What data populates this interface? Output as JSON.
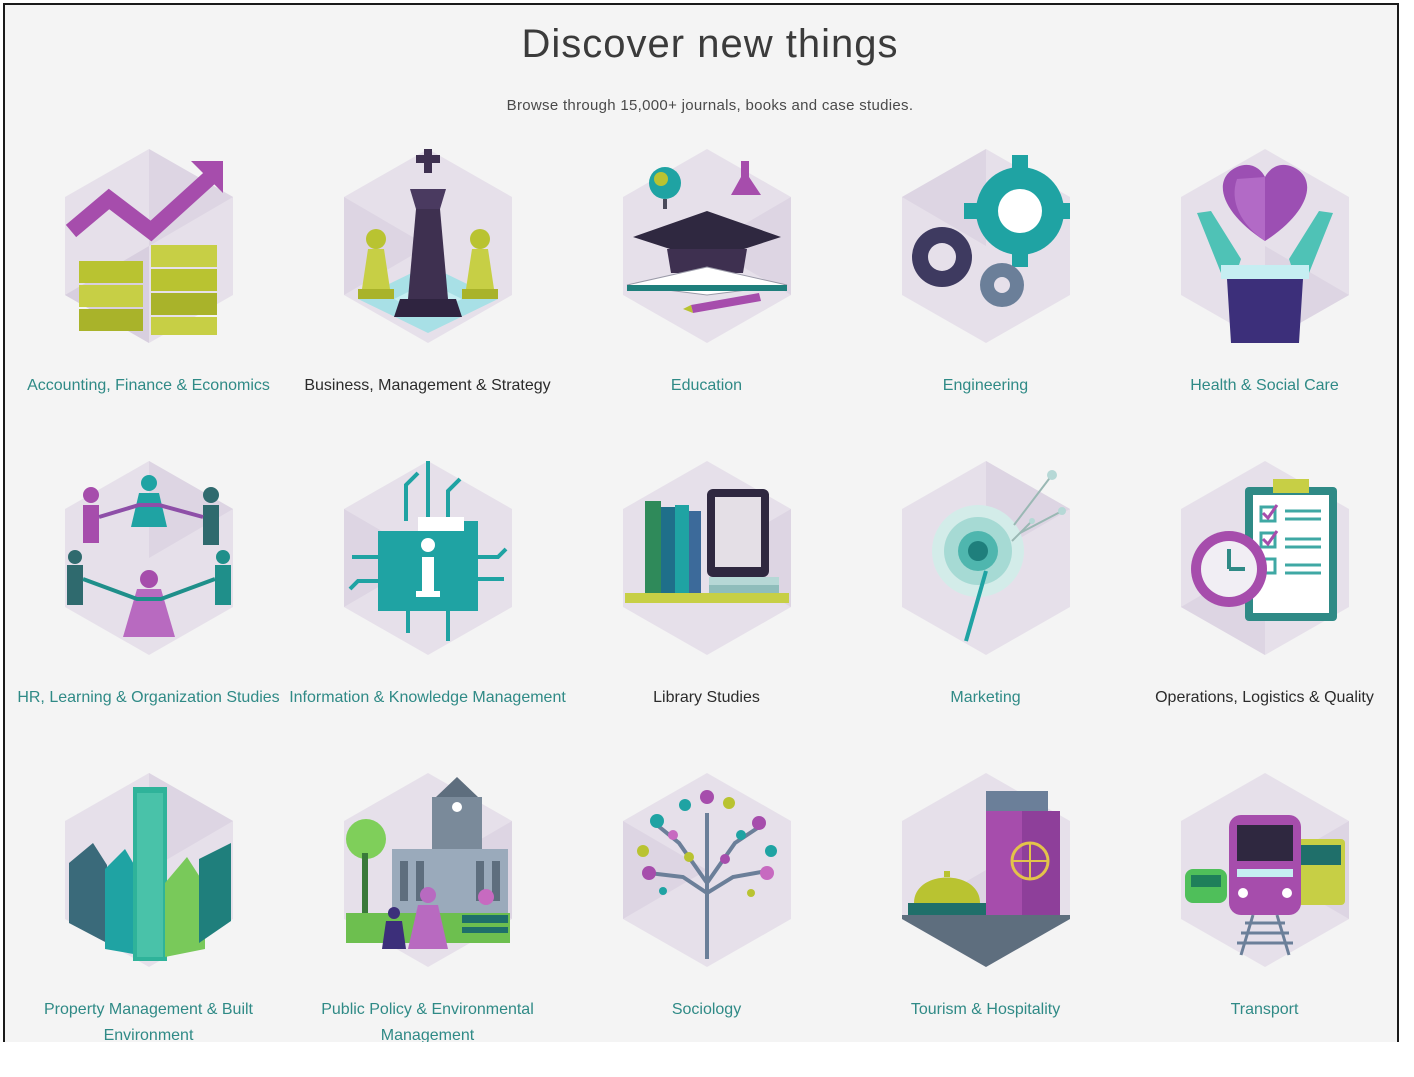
{
  "header": {
    "title": "Discover new things",
    "subtitle": "Browse through 15,000+ journals, books and case studies."
  },
  "categories": [
    {
      "label": "Accounting, Finance & Economics",
      "icon": "finance-chart-icon"
    },
    {
      "label": "Business, Management & Strategy",
      "icon": "chess-king-icon"
    },
    {
      "label": "Education",
      "icon": "graduation-cap-icon"
    },
    {
      "label": "Engineering",
      "icon": "gears-icon"
    },
    {
      "label": "Health & Social Care",
      "icon": "heart-hands-icon"
    },
    {
      "label": "HR, Learning & Organization Studies",
      "icon": "people-circle-icon"
    },
    {
      "label": "Information & Knowledge Management",
      "icon": "info-folder-icon"
    },
    {
      "label": "Library Studies",
      "icon": "books-tablet-icon"
    },
    {
      "label": "Marketing",
      "icon": "dandelion-icon"
    },
    {
      "label": "Operations, Logistics & Quality",
      "icon": "clock-clipboard-icon"
    },
    {
      "label": "Property Management & Built Environment",
      "icon": "buildings-icon"
    },
    {
      "label": "Public Policy & Environmental Management",
      "icon": "town-hall-icon"
    },
    {
      "label": "Sociology",
      "icon": "network-tree-icon"
    },
    {
      "label": "Tourism & Hospitality",
      "icon": "passport-bell-icon"
    },
    {
      "label": "Transport",
      "icon": "train-bus-icon"
    }
  ],
  "colors": {
    "accent": "#2f8a86",
    "purple": "#8e4fa8",
    "lime": "#b9c331",
    "teal": "#1fa3a3",
    "hex_bg": "#e3dde8"
  }
}
